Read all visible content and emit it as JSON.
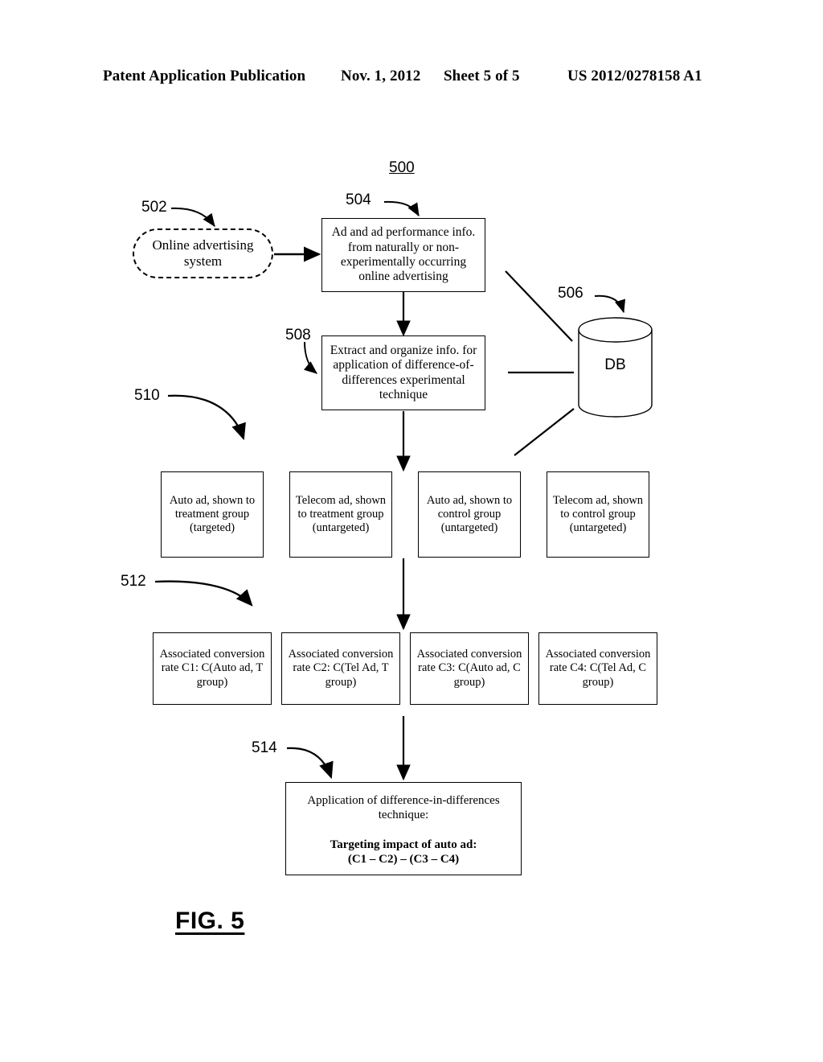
{
  "header": {
    "publication": "Patent Application Publication",
    "date": "Nov. 1, 2012",
    "sheet": "Sheet 5 of 5",
    "number": "US 2012/0278158 A1"
  },
  "figure": {
    "caption": "FIG. 5",
    "diagram_ref": "500"
  },
  "refs": {
    "r500": "500",
    "r502": "502",
    "r504": "504",
    "r506": "506",
    "r508": "508",
    "r510": "510",
    "r512": "512",
    "r514": "514"
  },
  "nodes": {
    "online_advertising_system": {
      "ref": "502",
      "label": "Online advertising system"
    },
    "ad_performance_info": {
      "ref": "504",
      "label": "Ad and ad performance info. from naturally or non-experimentally occurring online advertising"
    },
    "database": {
      "ref": "506",
      "label": "DB"
    },
    "extract_organize": {
      "ref": "508",
      "label": "Extract and organize info. for application of difference-of-differences experimental technique"
    }
  },
  "ad_group_row": {
    "ref": "510",
    "boxes": [
      {
        "label": "Auto ad, shown to treatment group (targeted)"
      },
      {
        "label": "Telecom ad, shown to treatment group (untargeted)"
      },
      {
        "label": "Auto ad, shown to control group (untargeted)"
      },
      {
        "label": "Telecom ad, shown to control group (untargeted)"
      }
    ]
  },
  "conversion_rate_row": {
    "ref": "512",
    "boxes": [
      {
        "label": "Associated conversion rate C1: C(Auto ad, T group)"
      },
      {
        "label": "Associated conversion rate C2: C(Tel Ad, T group)"
      },
      {
        "label": "Associated conversion rate C3: C(Auto ad, C group)"
      },
      {
        "label": "Associated conversion rate C4: C(Tel Ad, C group)"
      }
    ]
  },
  "result_node": {
    "ref": "514",
    "line1": "Application of difference-in-differences technique:",
    "line2": "Targeting impact of auto ad:",
    "line3": "(C1 – C2) – (C3 – C4)"
  },
  "colors": {
    "ink": "#000000",
    "paper": "#ffffff"
  }
}
